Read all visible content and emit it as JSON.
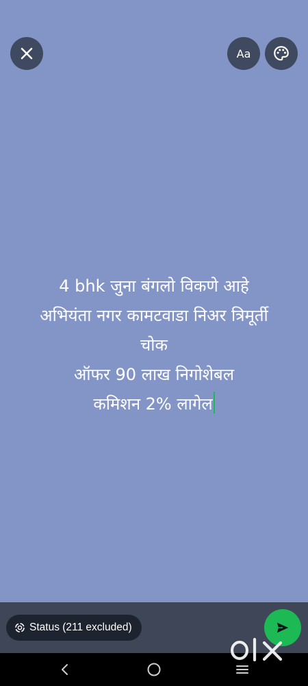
{
  "toolbar": {
    "close_icon": "close-icon",
    "font_label": "Aa",
    "palette_icon": "palette-icon"
  },
  "status": {
    "lines": [
      "4 bhk जुना बंगलो विकणे आहे",
      "अभियंता नगर कामटवाडा निअर त्रिमूर्ती",
      "चोक",
      "ऑफर 90 लाख निगोशेबल",
      "कमिशन 2% लागेल"
    ],
    "background_color": "#8395c7",
    "text_color": "#ffffff"
  },
  "audience": {
    "label": "Status (211 excluded)",
    "icon": "status-ring-icon"
  },
  "send": {
    "icon": "send-icon",
    "color": "#1db954"
  },
  "navigation": {
    "back_icon": "back-icon",
    "home_icon": "home-icon",
    "recents_icon": "recents-icon"
  },
  "watermark": {
    "text": "olx"
  }
}
